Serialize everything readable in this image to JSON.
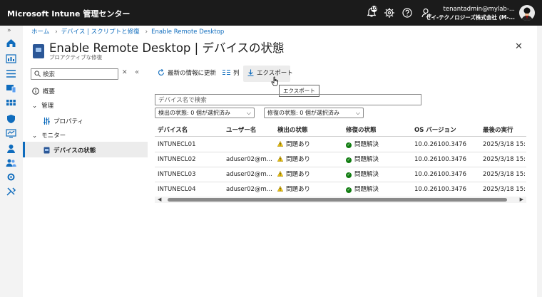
{
  "app": {
    "title": "Microsoft Intune 管理センター",
    "notification_count": "10",
    "user_email": "tenantadmin@mylab-...",
    "user_tenant": "セイ-テクノロジーズ株式会社 (M-..."
  },
  "breadcrumb": [
    "ホーム",
    "デバイス | スクリプトと修復",
    "Enable Remote Desktop"
  ],
  "page": {
    "title": "Enable Remote Desktop | デバイスの状態",
    "subtitle": "プロアクティブな修復",
    "more": "...",
    "close": "✕"
  },
  "nav": {
    "search_placeholder": "検索",
    "items": {
      "overview": "概要",
      "manage": "管理",
      "properties": "プロパティ",
      "monitor": "モニター",
      "device_status": "デバイスの状態"
    }
  },
  "toolbar": {
    "refresh": "最新の情報に更新",
    "columns": "列",
    "export": "エクスポート",
    "tooltip": "エクスポート"
  },
  "filters": {
    "device_search_placeholder": "デバイス名で検索",
    "detection": "検出の状態: 0 個が選択済み",
    "remediation": "修復の状態: 0 個が選択済み"
  },
  "table": {
    "headers": [
      "デバイス名",
      "ユーザー名",
      "検出の状態",
      "修復の状態",
      "OS バージョン",
      "最後の実行"
    ],
    "rows": [
      {
        "device": "INTUNECL01",
        "user": "",
        "detection": "問題あり",
        "remediation": "問題解決",
        "os": "10.0.26100.3476",
        "last_run": "2025/3/18 15:"
      },
      {
        "device": "INTUNECL02",
        "user": "aduser02@m...",
        "detection": "問題あり",
        "remediation": "問題解決",
        "os": "10.0.26100.3476",
        "last_run": "2025/3/18 15:"
      },
      {
        "device": "INTUNECL03",
        "user": "aduser02@m...",
        "detection": "問題あり",
        "remediation": "問題解決",
        "os": "10.0.26100.3476",
        "last_run": "2025/3/18 15:"
      },
      {
        "device": "INTUNECL04",
        "user": "aduser02@m...",
        "detection": "問題あり",
        "remediation": "問題解決",
        "os": "10.0.26100.3476",
        "last_run": "2025/3/18 15:"
      }
    ]
  },
  "colors": {
    "accent": "#0f6cbd",
    "warning": "#f2c811",
    "success": "#107c10",
    "topbar": "#1b1b1b"
  },
  "icons": {
    "detection_status": "warning-icon",
    "remediation_status": "checkmark-circle-icon"
  }
}
